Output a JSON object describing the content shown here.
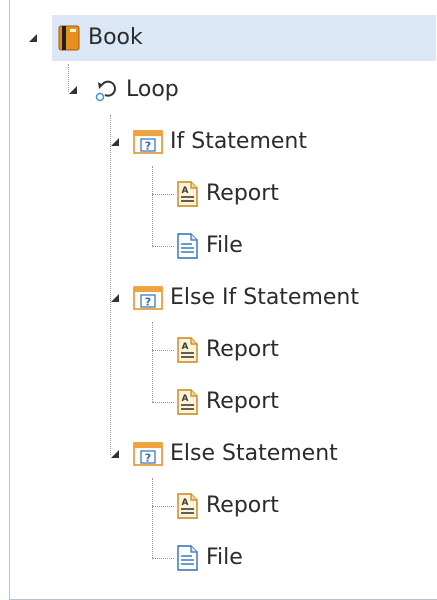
{
  "tree": {
    "book": {
      "label": "Book",
      "icon": "book-icon"
    },
    "loop": {
      "label": "Loop",
      "icon": "loop-icon"
    },
    "if_statement": {
      "label": "If Statement",
      "icon": "question-icon",
      "children": [
        {
          "label": "Report",
          "icon": "report-icon"
        },
        {
          "label": "File",
          "icon": "file-icon"
        }
      ]
    },
    "else_if_statement": {
      "label": "Else If Statement",
      "icon": "question-icon",
      "children": [
        {
          "label": "Report",
          "icon": "report-icon"
        },
        {
          "label": "Report",
          "icon": "report-icon"
        }
      ]
    },
    "else_statement": {
      "label": "Else Statement",
      "icon": "question-icon",
      "children": [
        {
          "label": "Report",
          "icon": "report-icon"
        },
        {
          "label": "File",
          "icon": "file-icon"
        }
      ]
    }
  },
  "colors": {
    "selection": "#dbe6f7",
    "book_orange": "#e6901e",
    "question_blue": "#2e6fb6"
  }
}
